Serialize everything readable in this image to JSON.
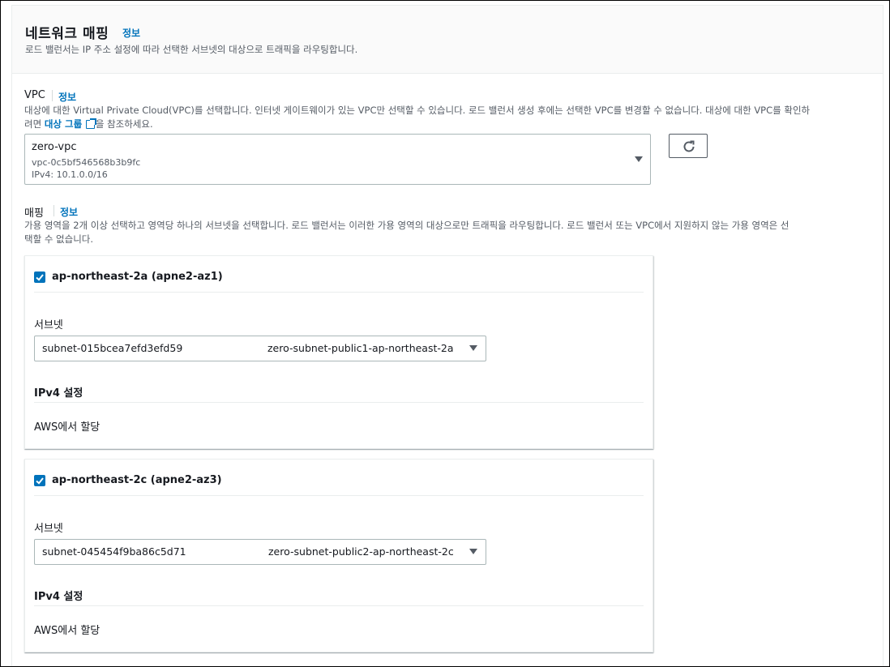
{
  "section": {
    "title": "네트워크 매핑",
    "info": "정보",
    "description": "로드 밸런서는 IP 주소 설정에 따라 선택한 서브넷의 대상으로 트래픽을 라우팅합니다."
  },
  "vpc": {
    "label": "VPC",
    "info": "정보",
    "description_line1": "대상에 대한 Virtual Private Cloud(VPC)를 선택합니다. 인터넷 게이트웨이가 있는 VPC만 선택할 수 있습니다. 로드 밸런서 생성 후에는 선택한 VPC를 변경할 수 없습니다. 대상에 대한 VPC를 확인하",
    "description_line2_pre": "려면 ",
    "description_link": "대상 그룹",
    "description_line2_post": "을 참조하세요.",
    "selected_name": "zero-vpc",
    "selected_id": "vpc-0c5bf546568b3b9fc",
    "selected_cidr": "IPv4: 10.1.0.0/16",
    "refresh_icon": "refresh-icon"
  },
  "mapping": {
    "label": "매핑",
    "info": "정보",
    "description_line1": "가용 영역을 2개 이상 선택하고 영역당 하나의 서브넷을 선택합니다. 로드 밸런서는 이러한 가용 영역의 대상으로만 트래픽을 라우팅합니다. 로드 밸런서 또는 VPC에서 지원하지 않는 가용 영역은 선",
    "description_line2": "택할 수 없습니다.",
    "zones": [
      {
        "name": "ap-northeast-2a (apne2-az1)",
        "checked": true,
        "subnet_label": "서브넷",
        "subnet_id": "subnet-015bcea7efd3efd59",
        "subnet_name": "zero-subnet-public1-ap-northeast-2a",
        "ipv4_title": "IPv4 설정",
        "ipv4_value": "AWS에서 할당"
      },
      {
        "name": "ap-northeast-2c (apne2-az3)",
        "checked": true,
        "subnet_label": "서브넷",
        "subnet_id": "subnet-045454f9ba86c5d71",
        "subnet_name": "zero-subnet-public2-ap-northeast-2c",
        "ipv4_title": "IPv4 설정",
        "ipv4_value": "AWS에서 할당"
      }
    ]
  },
  "colors": {
    "link": "#0073bb",
    "checkbox": "#0073bb",
    "text": "#16191f",
    "muted": "#545b64",
    "border": "#aab7b8",
    "header_bg": "#fafafa"
  }
}
